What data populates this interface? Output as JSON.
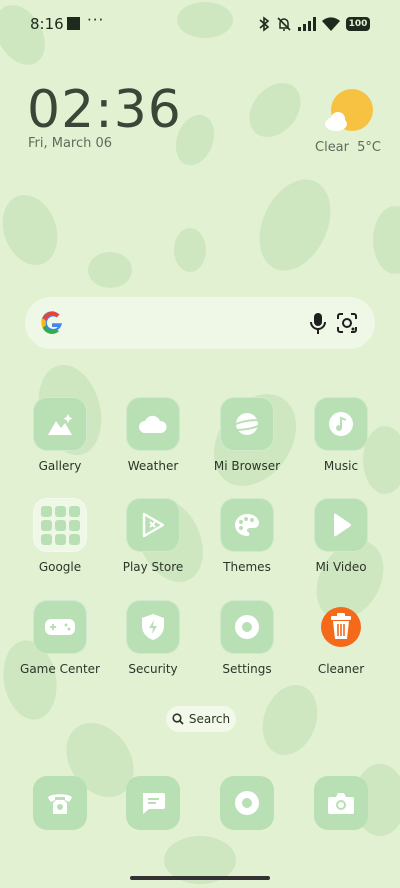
{
  "status_bar": {
    "time": "8:16",
    "overflow": "···",
    "battery": "100"
  },
  "clock": {
    "time": "02:36",
    "date": "Fri, March 06"
  },
  "weather": {
    "condition": "Clear",
    "temperature": "5°C"
  },
  "search": {
    "label": "Search"
  },
  "apps": [
    {
      "label": "Gallery",
      "icon": "gallery-icon"
    },
    {
      "label": "Weather",
      "icon": "cloud-icon"
    },
    {
      "label": "Mi Browser",
      "icon": "planet-icon"
    },
    {
      "label": "Music",
      "icon": "music-note-icon"
    },
    {
      "label": "Google",
      "icon": "folder-icon"
    },
    {
      "label": "Play Store",
      "icon": "play-store-icon"
    },
    {
      "label": "Themes",
      "icon": "palette-icon"
    },
    {
      "label": "Mi Video",
      "icon": "play-icon"
    },
    {
      "label": "Game Center",
      "icon": "gamepad-icon"
    },
    {
      "label": "Security",
      "icon": "shield-bolt-icon"
    },
    {
      "label": "Settings",
      "icon": "gear-icon"
    },
    {
      "label": "Cleaner",
      "icon": "trash-icon"
    }
  ],
  "dock": [
    "phone-icon",
    "message-icon",
    "browser-icon",
    "camera-icon"
  ],
  "colors": {
    "wallpaper": "#e2f1d2",
    "leaf": "#c9e6bb",
    "tile": "#b9dfb4",
    "cleaner_orange": "#f46a1a"
  }
}
